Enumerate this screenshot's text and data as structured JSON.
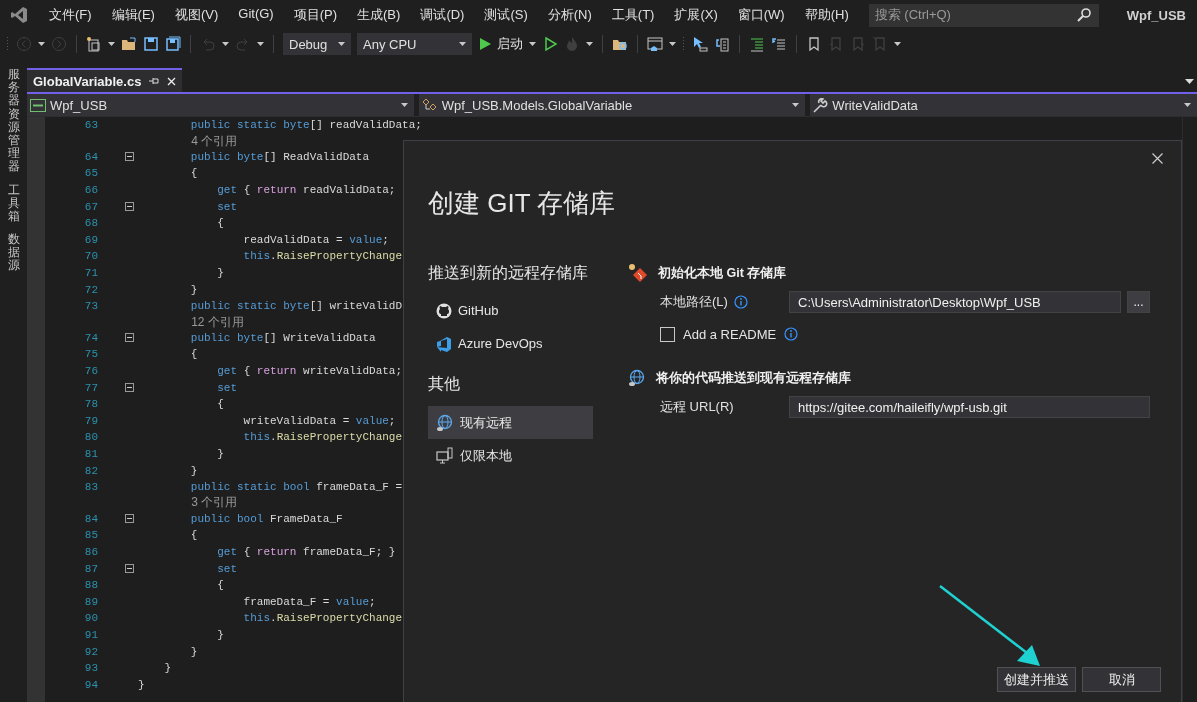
{
  "window": {
    "title": "Wpf_USB"
  },
  "menu": [
    "文件(F)",
    "编辑(E)",
    "视图(V)",
    "Git(G)",
    "项目(P)",
    "生成(B)",
    "调试(D)",
    "测试(S)",
    "分析(N)",
    "工具(T)",
    "扩展(X)",
    "窗口(W)",
    "帮助(H)"
  ],
  "search": {
    "placeholder": "搜索 (Ctrl+Q)"
  },
  "toolbar": {
    "configuration": "Debug",
    "platform": "Any CPU",
    "start": "启动",
    "buttons": [
      {
        "disabled": true
      },
      {
        "disabled": true
      },
      {
        "disabled": false
      },
      {
        "disabled": false
      },
      {
        "disabled": false
      },
      {
        "disabled": false
      },
      {
        "disabled": true
      },
      {
        "disabled": true
      },
      {
        "disabled": false
      },
      {
        "disabled": true
      },
      {
        "disabled": false
      },
      {
        "disabled": false
      },
      {
        "disabled": false
      },
      {
        "disabled": false
      },
      {
        "disabled": false
      },
      {
        "disabled": false
      },
      {
        "disabled": false
      },
      {
        "disabled": true
      },
      {
        "disabled": true
      },
      {
        "disabled": true
      }
    ]
  },
  "side_tabs": [
    "服务器资源管理器",
    "工具箱",
    "数据源"
  ],
  "tabs": [
    {
      "label": "GlobalVariable.cs",
      "selected": true
    }
  ],
  "navigation": [
    "Wpf_USB",
    "Wpf_USB.Models.GlobalVariable",
    "WriteValidData"
  ],
  "code_lines": [
    {
      "kind": "code",
      "number": "63",
      "fold": false,
      "tokens": [
        {
          "kind": "keyword",
          "text": "        public static byte"
        },
        {
          "kind": "plain",
          "text": "[] readValidData;"
        }
      ]
    },
    {
      "kind": "lens",
      "text": "4 个引用"
    },
    {
      "kind": "code",
      "number": "64",
      "fold": true,
      "tokens": [
        {
          "kind": "keyword",
          "text": "        public byte"
        },
        {
          "kind": "plain",
          "text": "[] ReadValidData"
        }
      ]
    },
    {
      "kind": "code",
      "number": "65",
      "fold": false,
      "tokens": [
        {
          "kind": "plain",
          "text": "        {"
        }
      ]
    },
    {
      "kind": "code",
      "number": "66",
      "fold": false,
      "tokens": [
        {
          "kind": "keyword",
          "text": "            get"
        },
        {
          "kind": "plain",
          "text": " { "
        },
        {
          "kind": "control",
          "text": "return"
        },
        {
          "kind": "plain",
          "text": " readValidData;"
        }
      ]
    },
    {
      "kind": "code",
      "number": "67",
      "fold": true,
      "tokens": [
        {
          "kind": "keyword",
          "text": "            set"
        }
      ]
    },
    {
      "kind": "code",
      "number": "68",
      "fold": false,
      "tokens": [
        {
          "kind": "plain",
          "text": "            {"
        }
      ]
    },
    {
      "kind": "code",
      "number": "69",
      "fold": false,
      "tokens": [
        {
          "kind": "plain",
          "text": "                readValidData = "
        },
        {
          "kind": "keyword",
          "text": "value"
        },
        {
          "kind": "plain",
          "text": ";"
        }
      ]
    },
    {
      "kind": "code",
      "number": "70",
      "fold": false,
      "tokens": [
        {
          "kind": "keyword",
          "text": "                this"
        },
        {
          "kind": "plain",
          "text": "."
        },
        {
          "kind": "method",
          "text": "RaisePropertyChange"
        }
      ]
    },
    {
      "kind": "code",
      "number": "71",
      "fold": false,
      "tokens": [
        {
          "kind": "plain",
          "text": "            }"
        }
      ]
    },
    {
      "kind": "code",
      "number": "72",
      "fold": false,
      "tokens": [
        {
          "kind": "plain",
          "text": "        }"
        }
      ]
    },
    {
      "kind": "code",
      "number": "73",
      "fold": false,
      "tokens": [
        {
          "kind": "keyword",
          "text": "        public static byte"
        },
        {
          "kind": "plain",
          "text": "[] writeValidD"
        }
      ]
    },
    {
      "kind": "lens",
      "text": "12 个引用"
    },
    {
      "kind": "code",
      "number": "74",
      "fold": true,
      "tokens": [
        {
          "kind": "keyword",
          "text": "        public byte"
        },
        {
          "kind": "plain",
          "text": "[] WriteValidData"
        }
      ]
    },
    {
      "kind": "code",
      "number": "75",
      "fold": false,
      "tokens": [
        {
          "kind": "plain",
          "text": "        {"
        }
      ]
    },
    {
      "kind": "code",
      "number": "76",
      "fold": false,
      "tokens": [
        {
          "kind": "keyword",
          "text": "            get"
        },
        {
          "kind": "plain",
          "text": " { "
        },
        {
          "kind": "control",
          "text": "return"
        },
        {
          "kind": "plain",
          "text": " writeValidData;"
        }
      ]
    },
    {
      "kind": "code",
      "number": "77",
      "fold": true,
      "tokens": [
        {
          "kind": "keyword",
          "text": "            set"
        }
      ]
    },
    {
      "kind": "code",
      "number": "78",
      "fold": false,
      "tokens": [
        {
          "kind": "plain",
          "text": "            {"
        }
      ]
    },
    {
      "kind": "code",
      "number": "79",
      "fold": false,
      "tokens": [
        {
          "kind": "plain",
          "text": "                writeValidData = "
        },
        {
          "kind": "keyword",
          "text": "value"
        },
        {
          "kind": "plain",
          "text": ";"
        }
      ]
    },
    {
      "kind": "code",
      "number": "80",
      "fold": false,
      "tokens": [
        {
          "kind": "keyword",
          "text": "                this"
        },
        {
          "kind": "plain",
          "text": "."
        },
        {
          "kind": "method",
          "text": "RaisePropertyChange"
        }
      ]
    },
    {
      "kind": "code",
      "number": "81",
      "fold": false,
      "tokens": [
        {
          "kind": "plain",
          "text": "            }"
        }
      ]
    },
    {
      "kind": "code",
      "number": "82",
      "fold": false,
      "tokens": [
        {
          "kind": "plain",
          "text": "        }"
        }
      ]
    },
    {
      "kind": "code",
      "number": "83",
      "fold": false,
      "tokens": [
        {
          "kind": "keyword",
          "text": "        public static bool"
        },
        {
          "kind": "plain",
          "text": " frameData_F ="
        }
      ]
    },
    {
      "kind": "lens",
      "text": "3 个引用"
    },
    {
      "kind": "code",
      "number": "84",
      "fold": true,
      "tokens": [
        {
          "kind": "keyword",
          "text": "        public bool"
        },
        {
          "kind": "plain",
          "text": " FrameData_F"
        }
      ]
    },
    {
      "kind": "code",
      "number": "85",
      "fold": false,
      "tokens": [
        {
          "kind": "plain",
          "text": "        {"
        }
      ]
    },
    {
      "kind": "code",
      "number": "86",
      "fold": false,
      "tokens": [
        {
          "kind": "keyword",
          "text": "            get"
        },
        {
          "kind": "plain",
          "text": " { "
        },
        {
          "kind": "control",
          "text": "return"
        },
        {
          "kind": "plain",
          "text": " frameData_F; }"
        }
      ]
    },
    {
      "kind": "code",
      "number": "87",
      "fold": true,
      "tokens": [
        {
          "kind": "keyword",
          "text": "            set"
        }
      ]
    },
    {
      "kind": "code",
      "number": "88",
      "fold": false,
      "tokens": [
        {
          "kind": "plain",
          "text": "            {"
        }
      ]
    },
    {
      "kind": "code",
      "number": "89",
      "fold": false,
      "tokens": [
        {
          "kind": "plain",
          "text": "                frameData_F = "
        },
        {
          "kind": "keyword",
          "text": "value"
        },
        {
          "kind": "plain",
          "text": ";"
        }
      ]
    },
    {
      "kind": "code",
      "number": "90",
      "fold": false,
      "tokens": [
        {
          "kind": "keyword",
          "text": "                this"
        },
        {
          "kind": "plain",
          "text": "."
        },
        {
          "kind": "method",
          "text": "RaisePropertyChange"
        }
      ]
    },
    {
      "kind": "code",
      "number": "91",
      "fold": false,
      "tokens": [
        {
          "kind": "plain",
          "text": "            }"
        }
      ]
    },
    {
      "kind": "code",
      "number": "92",
      "fold": false,
      "tokens": [
        {
          "kind": "plain",
          "text": "        }"
        }
      ]
    },
    {
      "kind": "code",
      "number": "93",
      "fold": false,
      "tokens": [
        {
          "kind": "plain",
          "text": "    }"
        }
      ]
    },
    {
      "kind": "code",
      "number": "94",
      "fold": false,
      "tokens": [
        {
          "kind": "plain",
          "text": "}"
        }
      ]
    }
  ],
  "dialog": {
    "title": "创建 GIT 存储库",
    "groups": [
      {
        "heading": "推送到新的远程存储库",
        "items": [
          {
            "label": "GitHub",
            "selected": false
          },
          {
            "label": "Azure DevOps",
            "selected": false
          }
        ]
      },
      {
        "heading": "其他",
        "items": [
          {
            "label": "现有远程",
            "selected": true
          },
          {
            "label": "仅限本地",
            "selected": false
          }
        ]
      }
    ],
    "local": {
      "heading": "初始化本地 Git 存储库",
      "path_label": "本地路径(L)",
      "path": "C:\\Users\\Administrator\\Desktop\\Wpf_USB",
      "browse": "...",
      "readme": {
        "label": "Add a README",
        "checked": false
      }
    },
    "remote": {
      "heading": "将你的代码推送到现有远程存储库",
      "url_label": "远程 URL(R)",
      "url": "https://gitee.com/haileifly/wpf-usb.git"
    },
    "buttons": [
      "创建并推送",
      "取消"
    ]
  }
}
